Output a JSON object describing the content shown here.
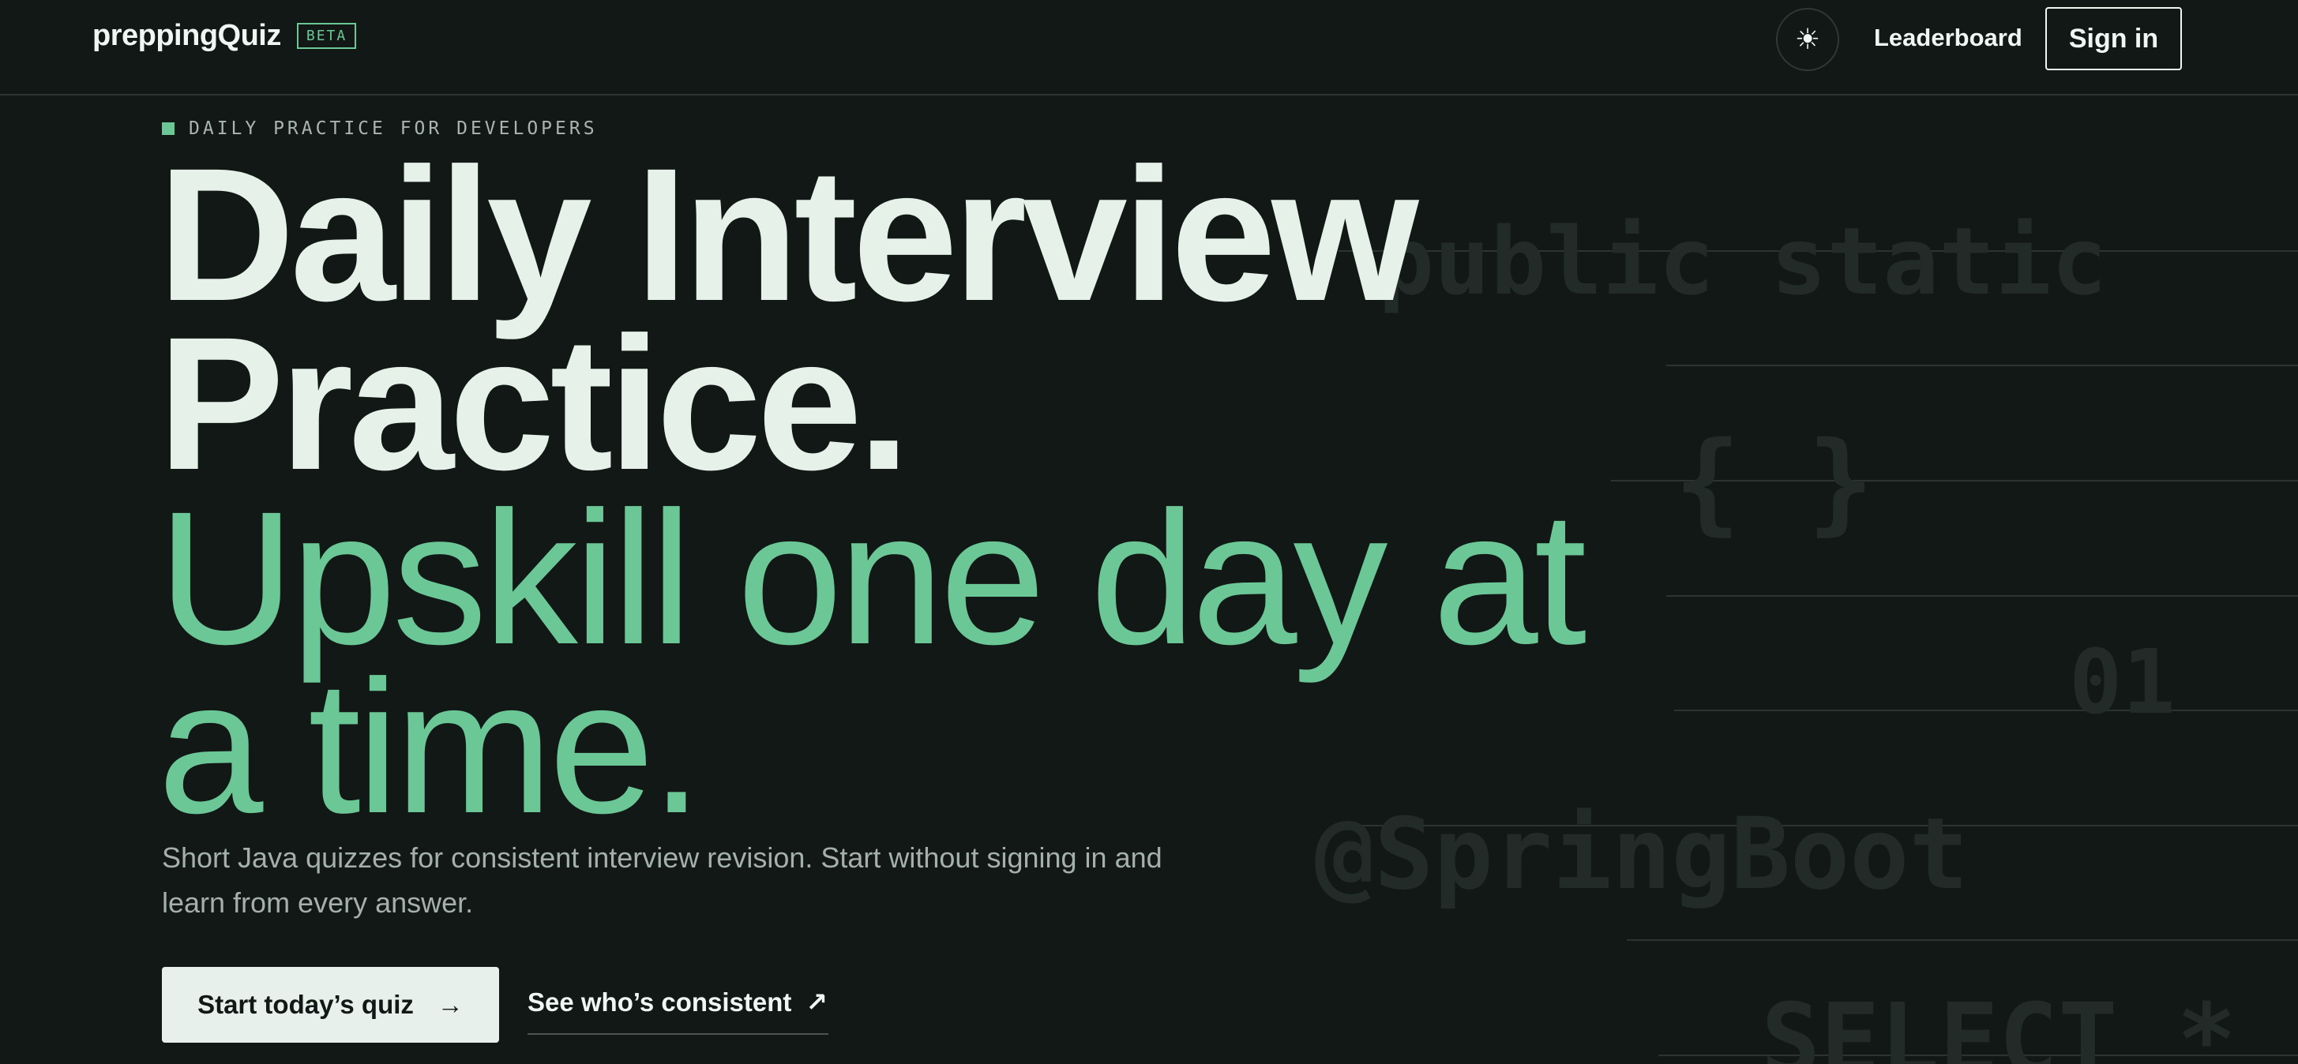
{
  "header": {
    "brand": "preppingQuiz",
    "badge": "BETA",
    "theme_toggle_icon": "sun-icon",
    "nav": {
      "leaderboard": "Leaderboard"
    },
    "signin_label": "Sign in"
  },
  "hero": {
    "eyebrow": "DAILY PRACTICE FOR DEVELOPERS",
    "headline_line1": "Daily Interview",
    "headline_line2": "Practice.",
    "subline_line1": "Upskill one day at",
    "subline_line2": "a time.",
    "lead": "Short Java quizzes for consistent interview revision. Start without signing in and learn from every answer.",
    "primary_cta": {
      "label": "Start today’s quiz",
      "icon": "→"
    },
    "secondary_cta": {
      "label": "See who’s consistent",
      "icon": "↗"
    }
  },
  "decorations": {
    "code1": "public static",
    "code2": "{ }",
    "code3": "01",
    "code4": "@SpringBoot",
    "code5": "SELECT *"
  },
  "colors": {
    "background": "#111816",
    "accent": "#6cc797",
    "text": "#e8f0ec"
  }
}
